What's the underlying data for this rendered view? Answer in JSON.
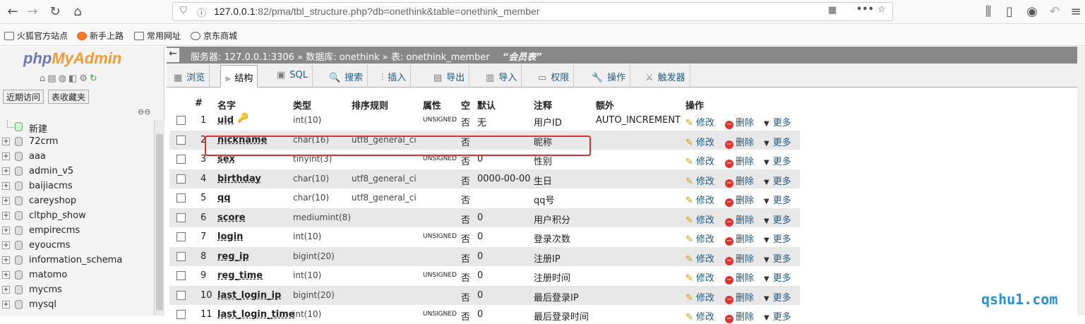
{
  "browser": {
    "url_host": "127.0.0.1",
    "url_rest": ":82/pma/tbl_structure.php?db=onethink&table=onethink_member",
    "bookmarks": [
      "火狐官方站点",
      "新手上路",
      "常用网址",
      "京东商城"
    ]
  },
  "left": {
    "logo_php": "php",
    "logo_myadmin": "MyAdmin",
    "tab_recent": "近期访问",
    "tab_favorites": "表收藏夹",
    "new_label": "新建",
    "databases": [
      "72crm",
      "aaa",
      "admin_v5",
      "baijiacms",
      "careyshop",
      "cltphp_show",
      "empirecms",
      "eyoucms",
      "information_schema",
      "matomo",
      "mycms",
      "mysql"
    ]
  },
  "breadcrumb": {
    "server": "服务器: 127.0.0.1:3306",
    "database": "数据库: onethink",
    "table": "表: onethink_member",
    "comment": "“会员表”"
  },
  "tabs": [
    "浏览",
    "结构",
    "SQL",
    "搜索",
    "插入",
    "导出",
    "导入",
    "权限",
    "操作",
    "触发器"
  ],
  "table": {
    "headers": [
      "#",
      "名字",
      "类型",
      "排序规则",
      "属性",
      "空",
      "默认",
      "注释",
      "额外",
      "操作"
    ],
    "rows": [
      {
        "n": "1",
        "name": "uid",
        "type": "int(10)",
        "collation": "",
        "attr": "UNSIGNED",
        "null": "否",
        "default": "无",
        "comment": "用户ID",
        "extra": "AUTO_INCREMENT"
      },
      {
        "n": "2",
        "name": "nickname",
        "type": "char(16)",
        "collation": "utf8_general_ci",
        "attr": "",
        "null": "否",
        "default": "",
        "comment": "昵称",
        "extra": ""
      },
      {
        "n": "3",
        "name": "sex",
        "type": "tinyint(3)",
        "collation": "",
        "attr": "UNSIGNED",
        "null": "否",
        "default": "0",
        "comment": "性别",
        "extra": ""
      },
      {
        "n": "4",
        "name": "birthday",
        "type": "char(10)",
        "collation": "utf8_general_ci",
        "attr": "",
        "null": "否",
        "default": "0000-00-00",
        "comment": "生日",
        "extra": ""
      },
      {
        "n": "5",
        "name": "qq",
        "type": "char(10)",
        "collation": "utf8_general_ci",
        "attr": "",
        "null": "否",
        "default": "",
        "comment": "qq号",
        "extra": ""
      },
      {
        "n": "6",
        "name": "score",
        "type": "mediumint(8)",
        "collation": "",
        "attr": "",
        "null": "否",
        "default": "0",
        "comment": "用户积分",
        "extra": ""
      },
      {
        "n": "7",
        "name": "login",
        "type": "int(10)",
        "collation": "",
        "attr": "UNSIGNED",
        "null": "否",
        "default": "0",
        "comment": "登录次数",
        "extra": ""
      },
      {
        "n": "8",
        "name": "reg_ip",
        "type": "bigint(20)",
        "collation": "",
        "attr": "",
        "null": "否",
        "default": "0",
        "comment": "注册IP",
        "extra": ""
      },
      {
        "n": "9",
        "name": "reg_time",
        "type": "int(10)",
        "collation": "",
        "attr": "UNSIGNED",
        "null": "否",
        "default": "0",
        "comment": "注册时间",
        "extra": ""
      },
      {
        "n": "10",
        "name": "last_login_ip",
        "type": "bigint(20)",
        "collation": "",
        "attr": "",
        "null": "否",
        "default": "0",
        "comment": "最后登录IP",
        "extra": ""
      },
      {
        "n": "11",
        "name": "last_login_time",
        "type": "int(10)",
        "collation": "",
        "attr": "UNSIGNED",
        "null": "否",
        "default": "0",
        "comment": "最后登录时间",
        "extra": ""
      }
    ],
    "action_edit": "修改",
    "action_delete": "删除",
    "action_more": "更多"
  },
  "watermark": "qshu1.com"
}
